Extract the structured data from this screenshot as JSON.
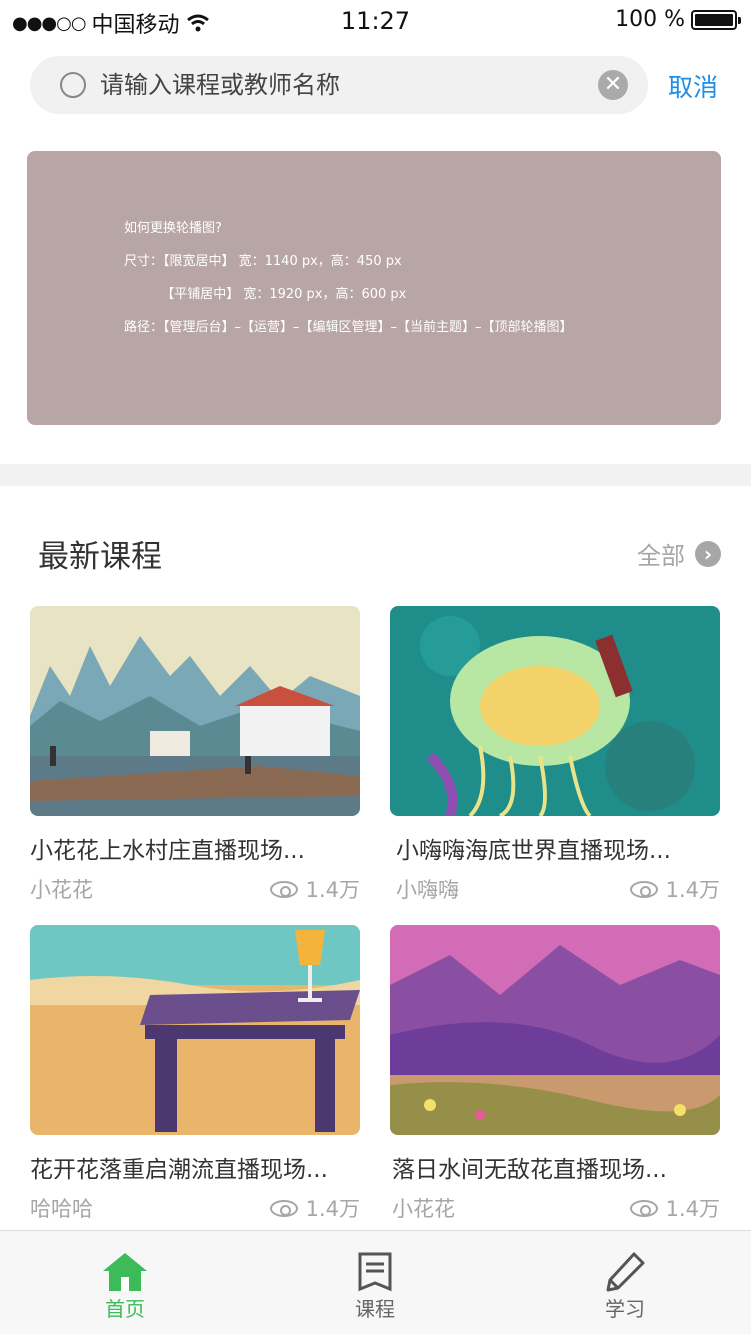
{
  "status_bar": {
    "carrier": "中国移动",
    "time": "11:27",
    "battery": "100 %"
  },
  "search": {
    "placeholder": "请输入课程或教师名称",
    "cancel_label": "取消"
  },
  "banner": {
    "title": "如何更换轮播图?",
    "lines": [
      "尺寸：【限宽居中】 宽：1140 px，高：450 px",
      "         【平铺居中】 宽：1920 px，高：600 px",
      "路径：【管理后台】–【运营】–【编辑区管理】–【当前主题】–【顶部轮播图】"
    ]
  },
  "section": {
    "title": "最新课程",
    "all_label": "全部"
  },
  "courses": [
    {
      "title": "小花花上水村庄直播现场...",
      "author": "小花花",
      "views": "1.4万"
    },
    {
      "title": "小嗨嗨海底世界直播现场...",
      "author": "小嗨嗨",
      "views": "1.4万"
    },
    {
      "title": "花开花落重启潮流直播现场...",
      "author": "哈哈哈",
      "views": "1.4万"
    },
    {
      "title": "落日水间无敌花直播现场...",
      "author": "小花花",
      "views": "1.4万"
    }
  ],
  "tabbar": {
    "items": [
      {
        "label": "首页",
        "icon": "home-icon",
        "active": true
      },
      {
        "label": "课程",
        "icon": "book-icon",
        "active": false
      },
      {
        "label": "学习",
        "icon": "pencil-icon",
        "active": false
      }
    ],
    "active_color": "#3dbb59",
    "inactive_color": "#666666"
  },
  "colors": {
    "accent": "#1e8ee8",
    "banner_bg": "#b8a5a6"
  }
}
